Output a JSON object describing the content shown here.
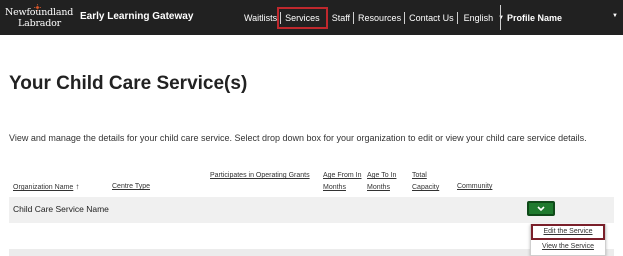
{
  "header": {
    "logo": {
      "line1": "Newfoundland",
      "line2": "Labrador"
    },
    "app_title": "Early Learning Gateway",
    "nav": [
      {
        "label": "Waitlists"
      },
      {
        "label": "Services"
      },
      {
        "label": "Staff"
      },
      {
        "label": "Resources"
      },
      {
        "label": "Contact Us"
      }
    ],
    "language": "English",
    "profile": "Profile Name"
  },
  "main": {
    "title": "Your Child Care Service(s)",
    "description": "View and manage the details for your child care service. Select drop down box for your organization to edit or view your child care service details.",
    "columns": [
      {
        "label": "Organization Name",
        "sort_icon": "arrow-up-icon"
      },
      {
        "label": "Centre Type"
      },
      {
        "label": "Participates in Operating Grants"
      },
      {
        "label": "Age From In Months"
      },
      {
        "label": "Age To In Months"
      },
      {
        "label": "Total Capacity"
      },
      {
        "label": "Community"
      }
    ],
    "rows": [
      {
        "organization_name": "Child Care Service Name"
      }
    ],
    "dropdown_icon": "chevron-down-icon",
    "menu": [
      {
        "label": "Edit the Service"
      },
      {
        "label": "View the Service"
      }
    ]
  },
  "colors": {
    "header_bg": "#212121",
    "active_nav_outline": "#c0282d",
    "button_green": "#1f7a2e",
    "menu_highlight": "#7a1f2a"
  }
}
